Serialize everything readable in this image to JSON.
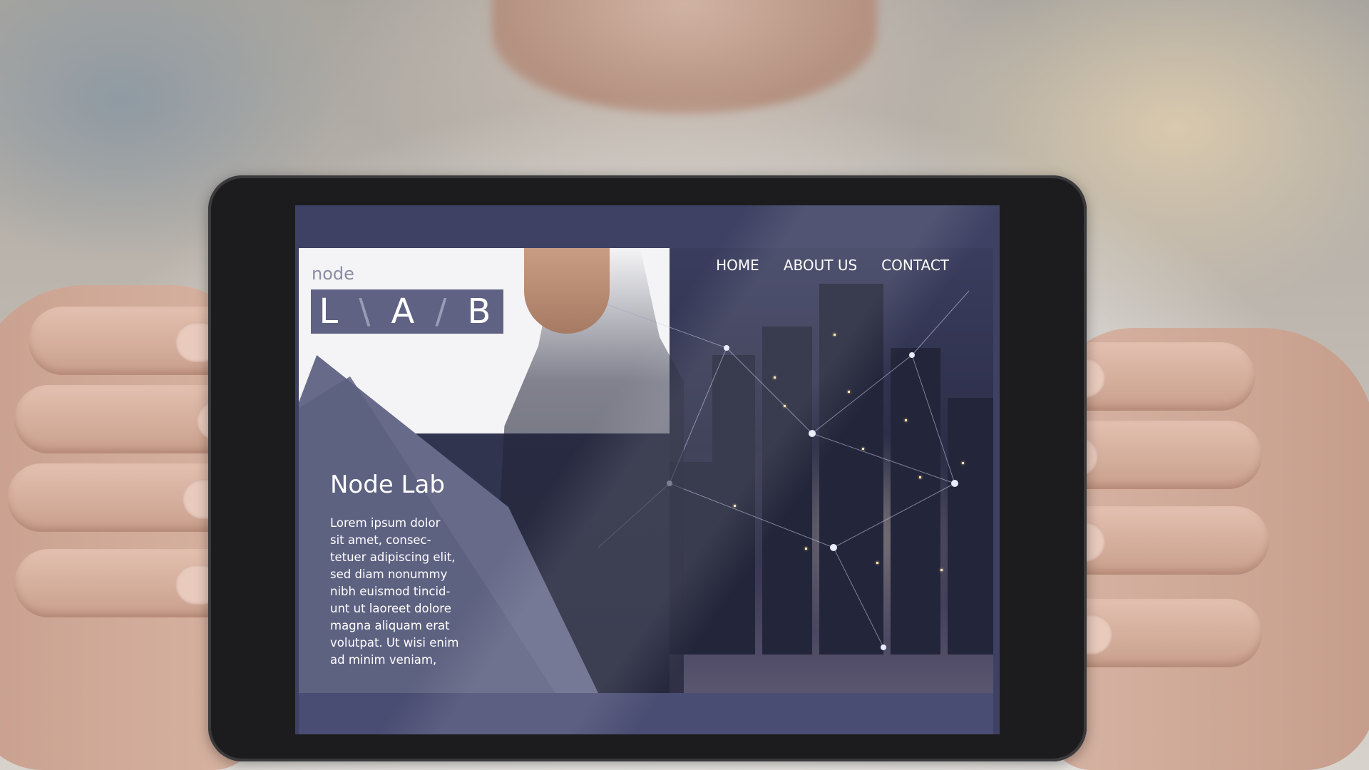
{
  "site": {
    "logo_small": "node",
    "logo_letters": [
      "L",
      "A",
      "B"
    ],
    "nav": [
      "HOME",
      "ABOUT US",
      "CONTACT"
    ],
    "hero_title": "Node Lab",
    "hero_body": "Lorem ipsum dolor\nsit amet, consec-\ntetuer adipiscing elit,\nsed diam nonummy\nnibh euismod tincid-\nunt ut laoreet dolore\nmagna aliquam erat\nvolutpat. Ut wisi enim\nad minim veniam,"
  },
  "colors": {
    "screen_bg": "#3e4163",
    "accent_purple": "#676a89",
    "logo_box": "#5f6283",
    "text_light": "#ffffff"
  }
}
